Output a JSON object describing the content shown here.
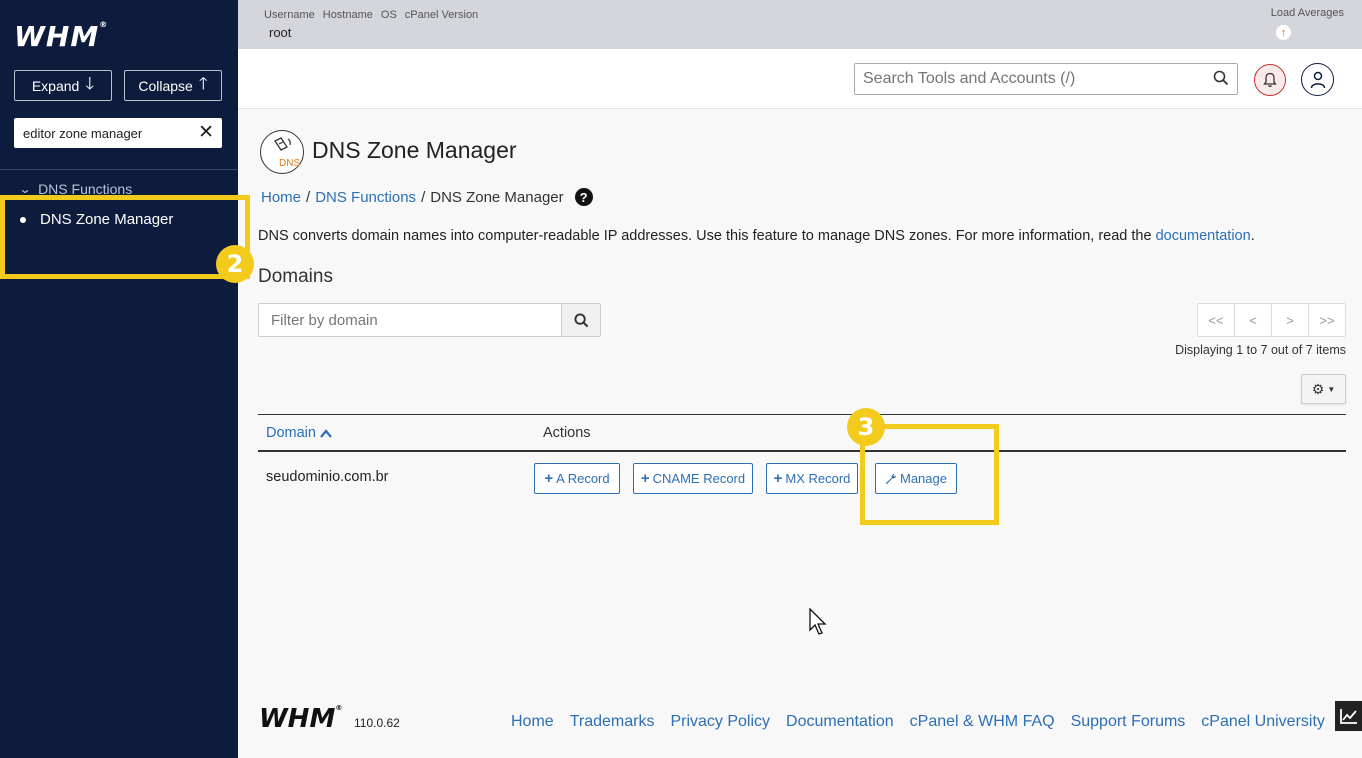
{
  "sidebar": {
    "logo": "WHM",
    "expand_label": "Expand",
    "collapse_label": "Collapse",
    "search_value": "editor zone manager",
    "group_label": "DNS Functions",
    "active_item": "DNS Zone Manager"
  },
  "annotations": {
    "step2": "2",
    "step3": "3",
    "highlight_color": "#f3cb1d"
  },
  "topbar": {
    "labels": [
      "Username",
      "Hostname",
      "OS",
      "cPanel Version"
    ],
    "username": "root",
    "load_label": "Load Averages"
  },
  "header": {
    "search_placeholder": "Search Tools and Accounts (/)"
  },
  "page": {
    "title": "DNS Zone Manager",
    "icon_text": "DNS",
    "breadcrumb": {
      "home": "Home",
      "group": "DNS Functions",
      "current": "DNS Zone Manager"
    },
    "intro_text": "DNS converts domain names into computer-readable IP addresses. Use this feature to manage DNS zones. For more information, read the ",
    "intro_link": "documentation",
    "intro_end": ".",
    "section_title": "Domains",
    "filter_placeholder": "Filter by domain",
    "pager": [
      "<<",
      "<",
      ">",
      ">>"
    ],
    "displaying": "Displaying 1 to 7 out of 7 items"
  },
  "table": {
    "headers": {
      "domain": "Domain",
      "actions": "Actions"
    },
    "rows": [
      {
        "domain": "seudominio.com.br",
        "actions": {
          "a_record": "A Record",
          "cname_record": "CNAME Record",
          "mx_record": "MX Record",
          "manage": "Manage"
        }
      }
    ]
  },
  "footer": {
    "logo": "WHM",
    "version": "110.0.62",
    "links": [
      "Home",
      "Trademarks",
      "Privacy Policy",
      "Documentation",
      "cPanel & WHM FAQ",
      "Support Forums",
      "cPanel University"
    ]
  },
  "colors": {
    "sidebar_bg": "#0d1b3d",
    "link": "#2d6fb5",
    "accent": "#f3cb1d"
  }
}
